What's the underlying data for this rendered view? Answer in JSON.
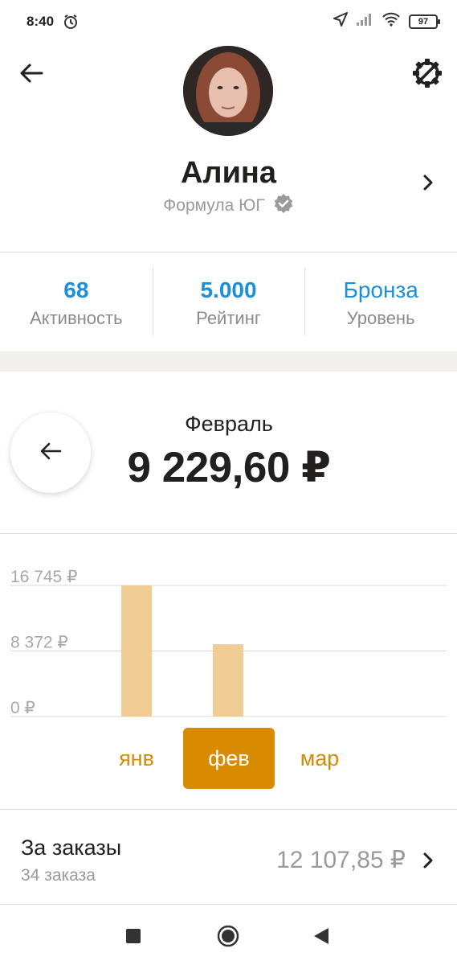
{
  "status_bar": {
    "time": "8:40",
    "battery": "97",
    "icons": [
      "alarm-icon",
      "location-arrow-icon",
      "signal-icon",
      "wifi-icon",
      "battery-icon"
    ]
  },
  "header": {
    "back_icon": "arrow-left-icon",
    "settings_icon": "gear-icon"
  },
  "profile": {
    "name": "Алина",
    "company": "Формула ЮГ",
    "verified_icon": "verified-badge-icon"
  },
  "stats": [
    {
      "value": "68",
      "label": "Активность"
    },
    {
      "value": "5.000",
      "label": "Рейтинг"
    },
    {
      "value": "Бронза",
      "label": "Уровень"
    }
  ],
  "summary": {
    "month": "Февраль",
    "amount": "9 229,60 ₽"
  },
  "chart_data": {
    "type": "bar",
    "categories": [
      "янв",
      "фев",
      "мар"
    ],
    "values": [
      16745,
      9229.6,
      0
    ],
    "title": "",
    "xlabel": "",
    "ylabel": "",
    "ylim": [
      0,
      16745
    ],
    "yticks": [
      "16 745 ₽",
      "8 372 ₽",
      "0 ₽"
    ],
    "ytick_values": [
      16745,
      8372,
      0
    ],
    "grid": true,
    "bar_color": "#f0cd94"
  },
  "month_tabs": {
    "items": [
      "янв",
      "фев",
      "мар"
    ],
    "selected": "фев"
  },
  "orders": {
    "title": "За заказы",
    "count": "34 заказа",
    "amount": "12 107,85 ₽"
  },
  "colors": {
    "accent_blue": "#1a8fdc",
    "accent_orange": "#d98b00",
    "bar": "#f0cd94"
  }
}
